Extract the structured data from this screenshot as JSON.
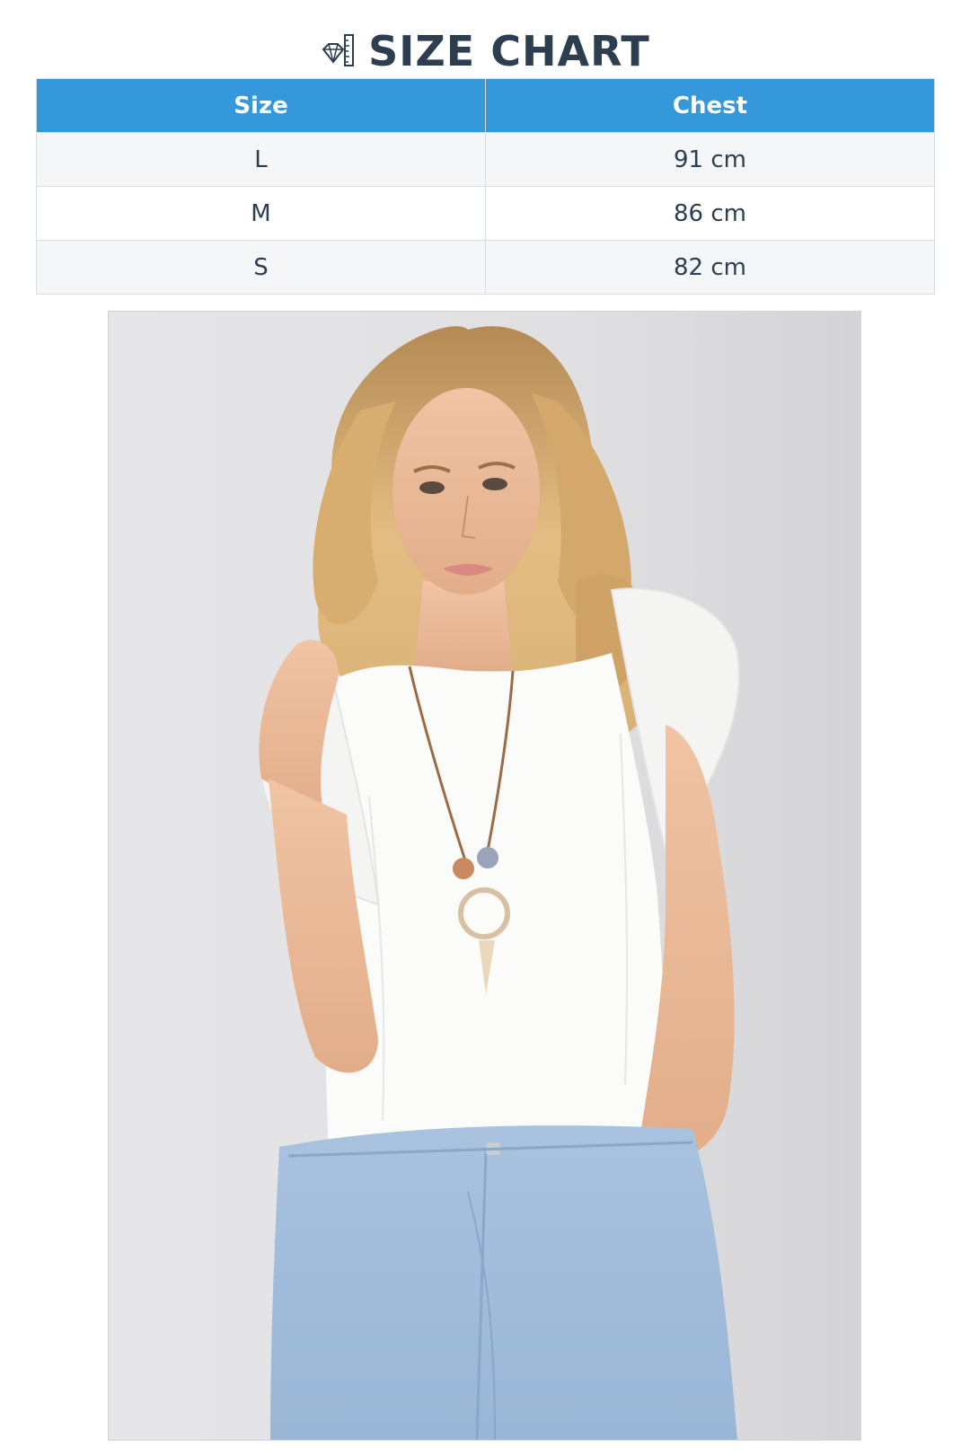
{
  "header": {
    "title": "SIZE CHART",
    "icon": "ruler-diamond-icon"
  },
  "table": {
    "columns": [
      "Size",
      "Chest"
    ],
    "rows": [
      {
        "size": "L",
        "chest": "91 cm"
      },
      {
        "size": "M",
        "chest": "86 cm"
      },
      {
        "size": "S",
        "chest": "82 cm"
      }
    ]
  },
  "colors": {
    "header_bg": "#3498db",
    "title_text": "#2c3e50",
    "row_alt_bg": "#f5f6f7"
  },
  "photo": {
    "subject": "model-wearing-white-ruffle-blouse-and-jeans"
  }
}
